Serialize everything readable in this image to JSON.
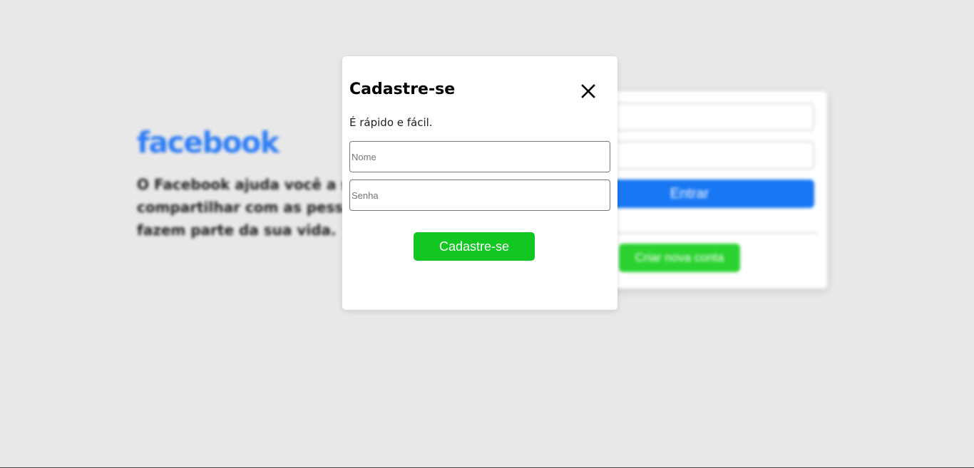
{
  "background": {
    "logo_text": "facebook",
    "tagline": "O Facebook ajuda você a se conectar e compartilhar com as pessoas que fazem parte da sua vida.",
    "tagline_line1": "O Facebook ajuda você a s",
    "tagline_line2": "compartilhar com as pess",
    "tagline_line3": "fazem parte da sua vida.",
    "login": {
      "email_placeholder": "",
      "password_placeholder": "",
      "login_label": "Entrar",
      "create_account_label": "Criar nova conta"
    }
  },
  "modal": {
    "title": "Cadastre-se",
    "subtitle": "É rápido e fácil.",
    "name_placeholder": "Nome",
    "password_placeholder": "Senha",
    "submit_label": "Cadastre-se",
    "close_icon": "close-icon"
  },
  "colors": {
    "brand_blue": "#1877f2",
    "logo_blue": "#2d7cf6",
    "signup_green": "#13c723",
    "overlay_bg": "#e8e8e8"
  }
}
